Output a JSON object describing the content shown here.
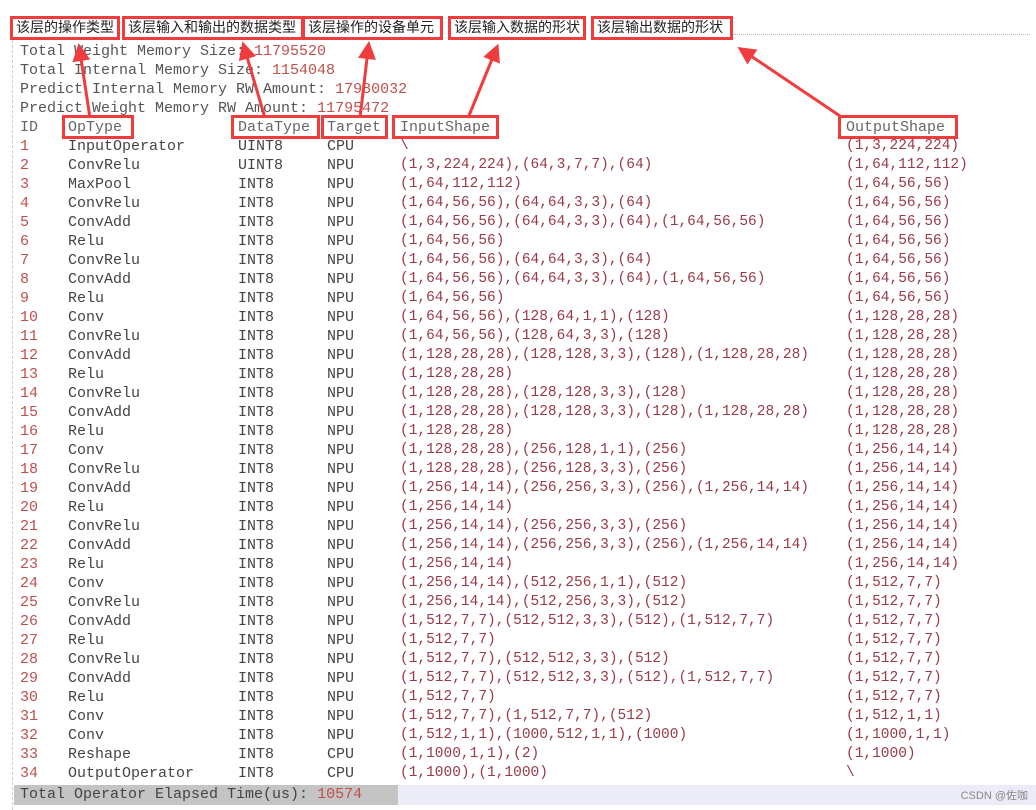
{
  "annotations": [
    "该层的操作类型",
    "该层输入和输出的数据类型",
    "该层操作的设备单元",
    "该层输入数据的形状",
    "该层输出数据的形状"
  ],
  "summary": [
    {
      "label": "Total Weight Memory Size: ",
      "value": "11795520"
    },
    {
      "label": "Total Internal Memory Size: ",
      "value": "1154048"
    },
    {
      "label": "Predict Internal Memory RW Amount: ",
      "value": "17980032"
    },
    {
      "label": "Predict Weight Memory RW Amount: ",
      "value": "11795472"
    }
  ],
  "headers": {
    "id": "ID",
    "op": "OpType",
    "dt": "DataType",
    "tg": "Target",
    "in": "InputShape",
    "out": "OutputShape"
  },
  "rows": [
    [
      "1",
      "InputOperator",
      "UINT8",
      "CPU",
      "\\",
      "(1,3,224,224)"
    ],
    [
      "2",
      "ConvRelu",
      "UINT8",
      "NPU",
      "(1,3,224,224),(64,3,7,7),(64)",
      "(1,64,112,112)"
    ],
    [
      "3",
      "MaxPool",
      "INT8",
      "NPU",
      "(1,64,112,112)",
      "(1,64,56,56)"
    ],
    [
      "4",
      "ConvRelu",
      "INT8",
      "NPU",
      "(1,64,56,56),(64,64,3,3),(64)",
      "(1,64,56,56)"
    ],
    [
      "5",
      "ConvAdd",
      "INT8",
      "NPU",
      "(1,64,56,56),(64,64,3,3),(64),(1,64,56,56)",
      "(1,64,56,56)"
    ],
    [
      "6",
      "Relu",
      "INT8",
      "NPU",
      "(1,64,56,56)",
      "(1,64,56,56)"
    ],
    [
      "7",
      "ConvRelu",
      "INT8",
      "NPU",
      "(1,64,56,56),(64,64,3,3),(64)",
      "(1,64,56,56)"
    ],
    [
      "8",
      "ConvAdd",
      "INT8",
      "NPU",
      "(1,64,56,56),(64,64,3,3),(64),(1,64,56,56)",
      "(1,64,56,56)"
    ],
    [
      "9",
      "Relu",
      "INT8",
      "NPU",
      "(1,64,56,56)",
      "(1,64,56,56)"
    ],
    [
      "10",
      "Conv",
      "INT8",
      "NPU",
      "(1,64,56,56),(128,64,1,1),(128)",
      "(1,128,28,28)"
    ],
    [
      "11",
      "ConvRelu",
      "INT8",
      "NPU",
      "(1,64,56,56),(128,64,3,3),(128)",
      "(1,128,28,28)"
    ],
    [
      "12",
      "ConvAdd",
      "INT8",
      "NPU",
      "(1,128,28,28),(128,128,3,3),(128),(1,128,28,28)",
      "(1,128,28,28)"
    ],
    [
      "13",
      "Relu",
      "INT8",
      "NPU",
      "(1,128,28,28)",
      "(1,128,28,28)"
    ],
    [
      "14",
      "ConvRelu",
      "INT8",
      "NPU",
      "(1,128,28,28),(128,128,3,3),(128)",
      "(1,128,28,28)"
    ],
    [
      "15",
      "ConvAdd",
      "INT8",
      "NPU",
      "(1,128,28,28),(128,128,3,3),(128),(1,128,28,28)",
      "(1,128,28,28)"
    ],
    [
      "16",
      "Relu",
      "INT8",
      "NPU",
      "(1,128,28,28)",
      "(1,128,28,28)"
    ],
    [
      "17",
      "Conv",
      "INT8",
      "NPU",
      "(1,128,28,28),(256,128,1,1),(256)",
      "(1,256,14,14)"
    ],
    [
      "18",
      "ConvRelu",
      "INT8",
      "NPU",
      "(1,128,28,28),(256,128,3,3),(256)",
      "(1,256,14,14)"
    ],
    [
      "19",
      "ConvAdd",
      "INT8",
      "NPU",
      "(1,256,14,14),(256,256,3,3),(256),(1,256,14,14)",
      "(1,256,14,14)"
    ],
    [
      "20",
      "Relu",
      "INT8",
      "NPU",
      "(1,256,14,14)",
      "(1,256,14,14)"
    ],
    [
      "21",
      "ConvRelu",
      "INT8",
      "NPU",
      "(1,256,14,14),(256,256,3,3),(256)",
      "(1,256,14,14)"
    ],
    [
      "22",
      "ConvAdd",
      "INT8",
      "NPU",
      "(1,256,14,14),(256,256,3,3),(256),(1,256,14,14)",
      "(1,256,14,14)"
    ],
    [
      "23",
      "Relu",
      "INT8",
      "NPU",
      "(1,256,14,14)",
      "(1,256,14,14)"
    ],
    [
      "24",
      "Conv",
      "INT8",
      "NPU",
      "(1,256,14,14),(512,256,1,1),(512)",
      "(1,512,7,7)"
    ],
    [
      "25",
      "ConvRelu",
      "INT8",
      "NPU",
      "(1,256,14,14),(512,256,3,3),(512)",
      "(1,512,7,7)"
    ],
    [
      "26",
      "ConvAdd",
      "INT8",
      "NPU",
      "(1,512,7,7),(512,512,3,3),(512),(1,512,7,7)",
      "(1,512,7,7)"
    ],
    [
      "27",
      "Relu",
      "INT8",
      "NPU",
      "(1,512,7,7)",
      "(1,512,7,7)"
    ],
    [
      "28",
      "ConvRelu",
      "INT8",
      "NPU",
      "(1,512,7,7),(512,512,3,3),(512)",
      "(1,512,7,7)"
    ],
    [
      "29",
      "ConvAdd",
      "INT8",
      "NPU",
      "(1,512,7,7),(512,512,3,3),(512),(1,512,7,7)",
      "(1,512,7,7)"
    ],
    [
      "30",
      "Relu",
      "INT8",
      "NPU",
      "(1,512,7,7)",
      "(1,512,7,7)"
    ],
    [
      "31",
      "Conv",
      "INT8",
      "NPU",
      "(1,512,7,7),(1,512,7,7),(512)",
      "(1,512,1,1)"
    ],
    [
      "32",
      "Conv",
      "INT8",
      "NPU",
      "(1,512,1,1),(1000,512,1,1),(1000)",
      "(1,1000,1,1)"
    ],
    [
      "33",
      "Reshape",
      "INT8",
      "CPU",
      "(1,1000,1,1),(2)",
      "(1,1000)"
    ],
    [
      "34",
      "OutputOperator",
      "INT8",
      "CPU",
      "(1,1000),(1,1000)",
      "\\"
    ]
  ],
  "total": {
    "label": "Total Operator Elapsed Time(us): ",
    "value": "10574"
  },
  "watermark": "CSDN @佐咖",
  "colors": {
    "annotation": "#f03c3c",
    "number": "#c0504d",
    "bracket": "#1a1a6e"
  }
}
